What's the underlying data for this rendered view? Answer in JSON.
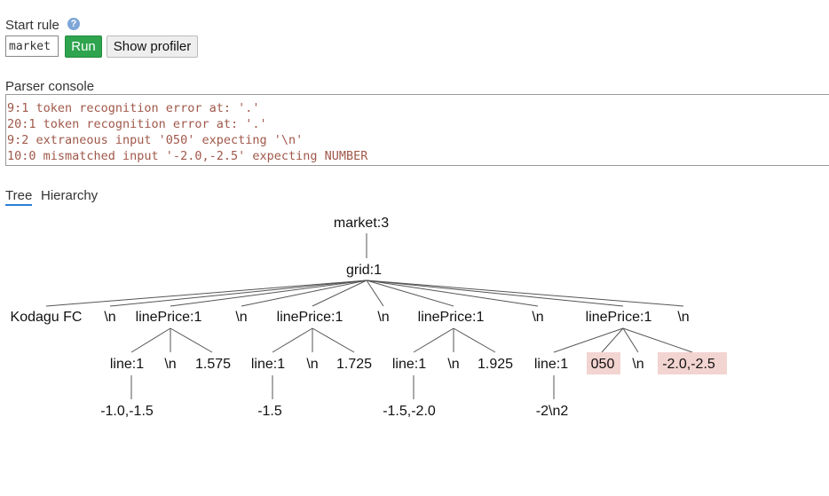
{
  "start_rule": {
    "label": "Start rule",
    "help_icon": "?",
    "value": "market",
    "run_label": "Run",
    "profiler_label": "Show profiler"
  },
  "console": {
    "label": "Parser console",
    "lines": [
      "9:1 token recognition error at: '.'",
      "20:1 token recognition error at: '.'",
      "9:2 extraneous input '050' expecting '\\n'",
      "10:0 mismatched input '-2.0,-2.5' expecting NUMBER"
    ]
  },
  "tabs": {
    "tree": "Tree",
    "hierarchy": "Hierarchy"
  },
  "colors": {
    "error_highlight": "#f2d4d0",
    "run_button": "#2ea44f",
    "console_text": "#a0584a",
    "active_tab": "#2a7fd4"
  },
  "tree": {
    "root": "market:3",
    "grid": "grid:1",
    "children": [
      {
        "label": "Kodagu FC"
      },
      {
        "label": "\\n"
      },
      {
        "label": "linePrice:1",
        "children": [
          {
            "label": "line:1",
            "child": "-1.0,-1.5"
          },
          {
            "label": "\\n"
          },
          {
            "label": "1.575"
          }
        ]
      },
      {
        "label": "\\n"
      },
      {
        "label": "linePrice:1",
        "children": [
          {
            "label": "line:1",
            "child": "-1.5"
          },
          {
            "label": "\\n"
          },
          {
            "label": "1.725"
          }
        ]
      },
      {
        "label": "\\n"
      },
      {
        "label": "linePrice:1",
        "children": [
          {
            "label": "line:1",
            "child": "-1.5,-2.0"
          },
          {
            "label": "\\n"
          },
          {
            "label": "1.925"
          }
        ]
      },
      {
        "label": "\\n"
      },
      {
        "label": "linePrice:1",
        "children": [
          {
            "label": "line:1",
            "child": "-2\\n2"
          },
          {
            "label": "050",
            "error": true
          },
          {
            "label": "\\n"
          },
          {
            "label": "-2.0,-2.5",
            "error": true
          }
        ]
      },
      {
        "label": "\\n"
      }
    ]
  }
}
